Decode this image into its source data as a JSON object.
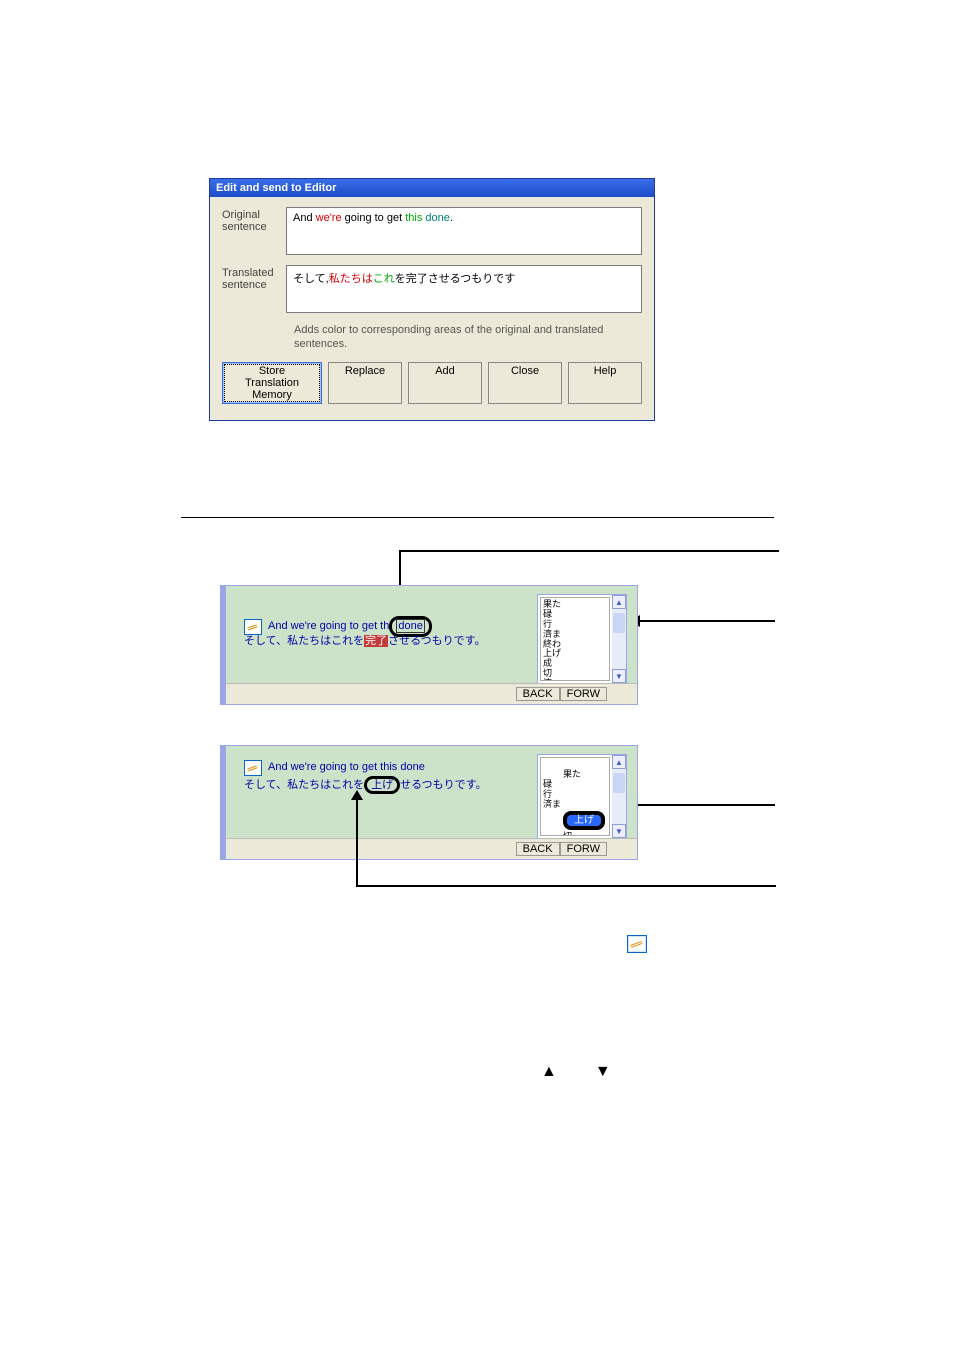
{
  "dialog": {
    "title": "Edit and send to Editor",
    "label_original": "Original sentence",
    "label_translated": "Translated sentence",
    "original": {
      "prefix": "And ",
      "we_are": "we're",
      "mid": " going to get ",
      "this": "this ",
      "done": "done",
      "end": "."
    },
    "translated": {
      "s1": "そして,",
      "s2": "私たちは",
      "s3": "これ",
      "s4": "を完了させるつもりです"
    },
    "hint": "Adds color to corresponding areas of the original and translated sentences.",
    "buttons": {
      "store": "Store Translation Memory",
      "replace": "Replace",
      "add": "Add",
      "close": "Close",
      "help": "Help"
    }
  },
  "pane1": {
    "en": {
      "pre": "And  we're going to get th",
      "done": "done"
    },
    "jp": {
      "pre": "そして、私たちはこれを",
      "kanryo": "完了",
      "post": "させるつもりです。"
    },
    "side_items": "果た\n碌\n行\n濟ま\n終わ\n上げ\n成\n切\n济",
    "back": "BACK",
    "forw": "FORW"
  },
  "pane2": {
    "en": "And  we're going to get this done",
    "jp": {
      "pre": "そして、私たちはこれを",
      "age": "上げ",
      "post": "せるつもりです。"
    },
    "side_items": "果た\n碌\n行\n済ま",
    "side_sel": "上げ",
    "side_items2": "切\n济",
    "back": "BACK",
    "forw": "FORW"
  },
  "triangles": "▲▼"
}
